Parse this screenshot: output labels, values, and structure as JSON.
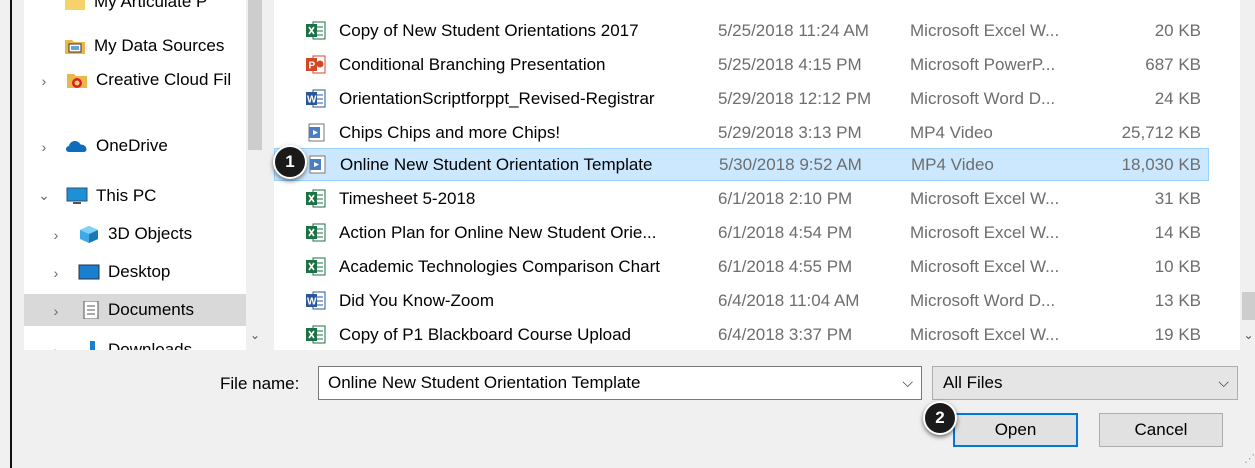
{
  "nav": {
    "items": [
      {
        "label": "My Articulate P",
        "icon": "folder-icon",
        "chevron": ""
      },
      {
        "label": "My Data Sources",
        "icon": "data-sources-icon",
        "chevron": ""
      },
      {
        "label": "Creative Cloud Fil",
        "icon": "creative-cloud-icon",
        "chevron": "›"
      },
      {
        "label": "OneDrive",
        "icon": "onedrive-icon",
        "chevron": "›"
      },
      {
        "label": "This PC",
        "icon": "computer-icon",
        "chevron": "⌄"
      },
      {
        "label": "3D Objects",
        "icon": "3d-objects-icon",
        "chevron": "›"
      },
      {
        "label": "Desktop",
        "icon": "desktop-icon",
        "chevron": "›"
      },
      {
        "label": "Documents",
        "icon": "documents-icon",
        "chevron": "›"
      },
      {
        "label": "Downloads",
        "icon": "downloads-icon",
        "chevron": "›"
      }
    ]
  },
  "files": [
    {
      "name": "Copy of New Student Orientations 2017",
      "date": "5/25/2018 11:24 AM",
      "type": "Microsoft Excel W...",
      "size": "20 KB",
      "icon": "excel-icon"
    },
    {
      "name": "Conditional Branching Presentation",
      "date": "5/25/2018 4:15 PM",
      "type": "Microsoft PowerP...",
      "size": "687 KB",
      "icon": "powerpoint-icon"
    },
    {
      "name": "OrientationScriptforppt_Revised-Registrar",
      "date": "5/29/2018 12:12 PM",
      "type": "Microsoft Word D...",
      "size": "24 KB",
      "icon": "word-icon"
    },
    {
      "name": "Chips Chips and more Chips!",
      "date": "5/29/2018 3:13 PM",
      "type": "MP4 Video",
      "size": "25,712 KB",
      "icon": "video-icon"
    },
    {
      "name": "Online New Student Orientation Template",
      "date": "5/30/2018 9:52 AM",
      "type": "MP4 Video",
      "size": "18,030 KB",
      "icon": "video-icon"
    },
    {
      "name": "Timesheet 5-2018",
      "date": "6/1/2018 2:10 PM",
      "type": "Microsoft Excel W...",
      "size": "31 KB",
      "icon": "excel-icon"
    },
    {
      "name": "Action Plan for Online New Student Orie...",
      "date": "6/1/2018 4:54 PM",
      "type": "Microsoft Excel W...",
      "size": "14 KB",
      "icon": "excel-icon"
    },
    {
      "name": "Academic Technologies Comparison Chart",
      "date": "6/1/2018 4:55 PM",
      "type": "Microsoft Excel W...",
      "size": "10 KB",
      "icon": "excel-icon"
    },
    {
      "name": "Did You Know-Zoom",
      "date": "6/4/2018 11:04 AM",
      "type": "Microsoft Word D...",
      "size": "13 KB",
      "icon": "word-icon"
    },
    {
      "name": "Copy of P1 Blackboard Course Upload",
      "date": "6/4/2018 3:37 PM",
      "type": "Microsoft Excel W...",
      "size": "19 KB",
      "icon": "excel-icon"
    }
  ],
  "filename": {
    "label": "File name:",
    "value": "Online New Student Orientation Template"
  },
  "filetype": {
    "value": "All Files"
  },
  "buttons": {
    "open": "Open",
    "cancel": "Cancel"
  },
  "callouts": {
    "first": "1",
    "second": "2"
  },
  "icons": {
    "dropdown": "⌵",
    "scroll_down": "⌄",
    "grip": "⋰"
  },
  "colors": {
    "selection": "#cce8ff",
    "accent": "#0078d7",
    "excel": "#1e7145",
    "word": "#2b579a",
    "powerpoint": "#d24726"
  }
}
